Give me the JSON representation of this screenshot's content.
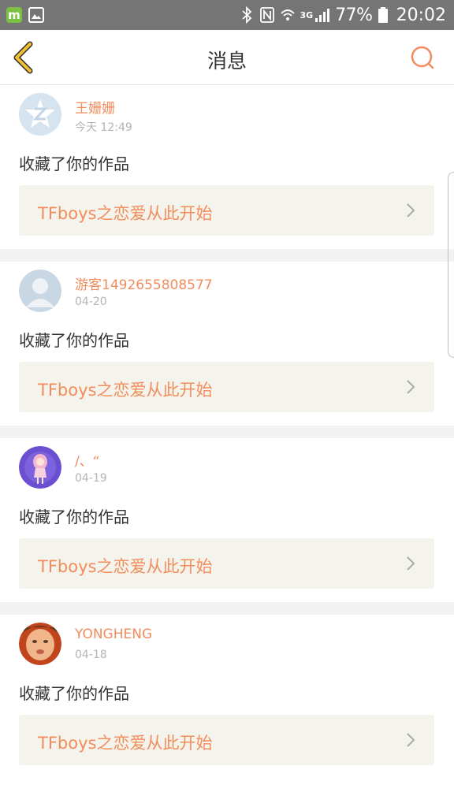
{
  "status_bar": {
    "network": "3G",
    "battery": "77%",
    "time": "20:02"
  },
  "header": {
    "title": "消息"
  },
  "messages": [
    {
      "user": "王姗姗",
      "date": "今天 12:49",
      "action": "收藏了你的作品",
      "work_title": "TFboys之恋爱从此开始"
    },
    {
      "user": "游客1492655808577",
      "date": "04-20",
      "action": "收藏了你的作品",
      "work_title": "TFboys之恋爱从此开始"
    },
    {
      "user": "/、“",
      "date": "04-19",
      "action": "收藏了你的作品",
      "work_title": "TFboys之恋爱从此开始"
    },
    {
      "user": "YONGHENG",
      "date": "04-18",
      "action": "收藏了你的作品",
      "work_title": "TFboys之恋爱从此开始"
    }
  ],
  "colors": {
    "accent": "#f28c5c",
    "back_icon": "#f0c030",
    "card_link_bg": "#f4f4ec",
    "status_bar": "#757575"
  }
}
